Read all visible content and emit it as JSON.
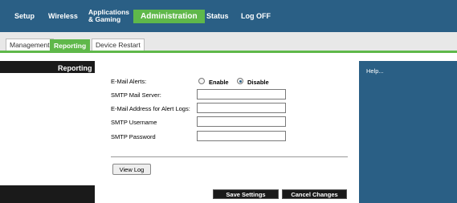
{
  "nav": {
    "items": [
      {
        "label": "Setup"
      },
      {
        "label": "Wireless"
      },
      {
        "label_line1": "Applications",
        "label_line2": "& Gaming"
      },
      {
        "label": "Administration",
        "active": true
      },
      {
        "label": "Status"
      },
      {
        "label": "Log OFF"
      }
    ]
  },
  "subtabs": [
    {
      "label": "Management"
    },
    {
      "label": "Reporting",
      "active": true
    },
    {
      "label": "Device Restart"
    }
  ],
  "section": {
    "title": "Reporting"
  },
  "help": {
    "label": "Help..."
  },
  "form": {
    "email_alerts": {
      "label": "E-Mail Alerts:",
      "options": [
        {
          "label": "Enable",
          "checked": false
        },
        {
          "label": "Disable",
          "checked": true
        }
      ]
    },
    "smtp_server": {
      "label": "SMTP Mail Server:",
      "value": ""
    },
    "email_address": {
      "label": "E-Mail Address for Alert Logs:",
      "value": ""
    },
    "smtp_username": {
      "label": "SMTP Username",
      "value": ""
    },
    "smtp_password": {
      "label": "SMTP Password",
      "value": ""
    }
  },
  "view_log_button": "View Log",
  "footer": {
    "save_label": "Save Settings",
    "cancel_label": "Cancel Changes"
  },
  "colors": {
    "nav_blue": "#2a5f85",
    "accent_green": "#5fb84a",
    "footer_black": "#1a1a1a"
  }
}
